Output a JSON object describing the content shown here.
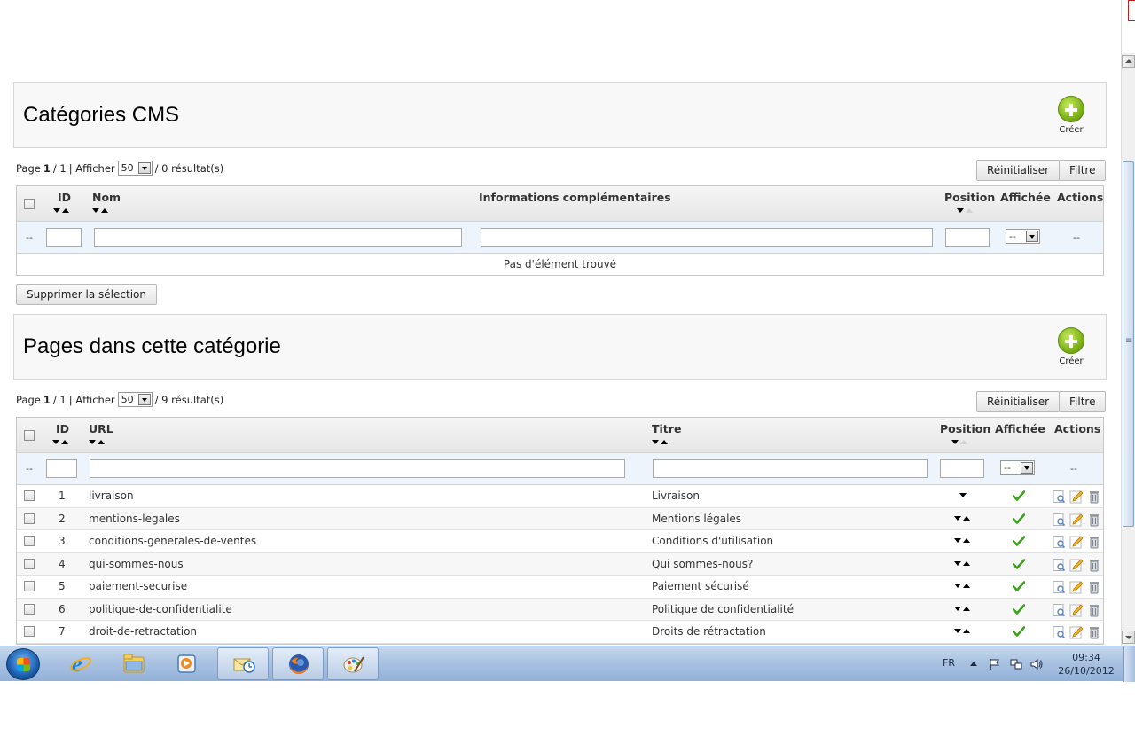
{
  "section1": {
    "title": "Catégories CMS",
    "create_label": "Créer",
    "pager": {
      "page_label": "Page",
      "page_current": "1",
      "page_total": "/ 1",
      "show_label": "| Afficher",
      "per_page": "50",
      "results": "/ 0 résultat(s)"
    },
    "reset_label": "Réinitialiser",
    "filter_label": "Filtre",
    "columns": {
      "id": "ID",
      "name": "Nom",
      "info": "Informations complémentaires",
      "position": "Position",
      "displayed": "Affichée",
      "actions": "Actions"
    },
    "filter_dash": "--",
    "filter_select": "--",
    "actions_dash": "--",
    "empty_message": "Pas d'élément trouvé"
  },
  "delete_selection_label": "Supprimer la sélection",
  "section2": {
    "title": "Pages dans cette catégorie",
    "create_label": "Créer",
    "pager": {
      "page_label": "Page",
      "page_current": "1",
      "page_total": "/ 1",
      "show_label": "| Afficher",
      "per_page": "50",
      "results": "/ 9 résultat(s)"
    },
    "reset_label": "Réinitialiser",
    "filter_label": "Filtre",
    "columns": {
      "id": "ID",
      "url": "URL",
      "title": "Titre",
      "position": "Position",
      "displayed": "Affichée",
      "actions": "Actions"
    },
    "filter_dash": "--",
    "filter_select": "--",
    "actions_dash": "--",
    "rows": [
      {
        "id": "1",
        "url": "livraison",
        "title": "Livraison",
        "first": true
      },
      {
        "id": "2",
        "url": "mentions-legales",
        "title": "Mentions légales"
      },
      {
        "id": "3",
        "url": "conditions-generales-de-ventes",
        "title": "Conditions d'utilisation"
      },
      {
        "id": "4",
        "url": "qui-sommes-nous",
        "title": "Qui sommes-nous?"
      },
      {
        "id": "5",
        "url": "paiement-securise",
        "title": "Paiement sécurisé"
      },
      {
        "id": "6",
        "url": "politique-de-confidentialite",
        "title": "Politique de confidentialité"
      },
      {
        "id": "7",
        "url": "droit-de-retractation",
        "title": "Droits de rétractation"
      }
    ]
  },
  "icons": {
    "create": "plus-circle-icon",
    "enabled": "green-check-icon",
    "view": "view-icon",
    "edit": "edit-pencil-icon",
    "delete": "trash-icon"
  },
  "colors": {
    "accent_green": "#7fb21b",
    "filter_row": "#edf4fb",
    "check_green": "#3aa11a"
  },
  "taskbar": {
    "language": "FR",
    "time": "09:34",
    "date": "26/10/2012",
    "apps": [
      "internet-explorer",
      "file-explorer",
      "media-player",
      "outlook",
      "firefox",
      "paint"
    ]
  }
}
